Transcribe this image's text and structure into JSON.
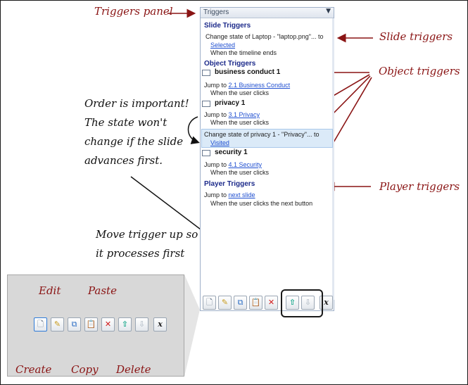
{
  "annotations": {
    "triggers_panel": "Triggers panel",
    "slide_triggers": "Slide triggers",
    "object_triggers": "Object triggers",
    "player_triggers": "Player triggers",
    "order_note": [
      "Order is important!",
      "The state won't",
      "change if the slide",
      "advances first."
    ],
    "move_note": [
      "Move trigger up so",
      "it processes first"
    ],
    "edit": "Edit",
    "paste": "Paste",
    "create": "Create",
    "copy": "Copy",
    "delete": "Delete"
  },
  "panel": {
    "title": "Triggers",
    "slide_section": "Slide Triggers",
    "slide_trigger": {
      "action": "Change state of Laptop - \"laptop.png\"... to",
      "state": "Selected",
      "when": "When the timeline ends"
    },
    "object_section": "Object Triggers",
    "objects": [
      {
        "name": "business conduct 1",
        "jump": "Jump to",
        "target": "2.1 Business Conduct",
        "when": "When the user clicks"
      },
      {
        "name": "privacy 1",
        "jump": "Jump to",
        "target": "3.1 Privacy",
        "when": "When the user clicks",
        "extra_action": "Change state of privacy 1 - \"Privacy\"... to",
        "extra_state": "Visited"
      },
      {
        "name": "security 1",
        "jump": "Jump to",
        "target": "4.1 Security",
        "when": "When the user clicks"
      }
    ],
    "player_section": "Player Triggers",
    "player_trigger": {
      "jump": "Jump to",
      "target": "next slide",
      "when": "When the user clicks the next button"
    }
  },
  "toolbar": {
    "icons": [
      "create-icon",
      "edit-icon",
      "copy-icon",
      "paste-icon",
      "delete-icon",
      "move-up-icon",
      "move-down-icon",
      "variables-icon"
    ],
    "variables_label": "x"
  },
  "colors": {
    "annotation_red": "#8a1414",
    "section_blue": "#1c2a8a",
    "link_blue": "#1f4fd0",
    "selection": "#dbeaf8",
    "inset_bg": "#d8d8d8"
  }
}
